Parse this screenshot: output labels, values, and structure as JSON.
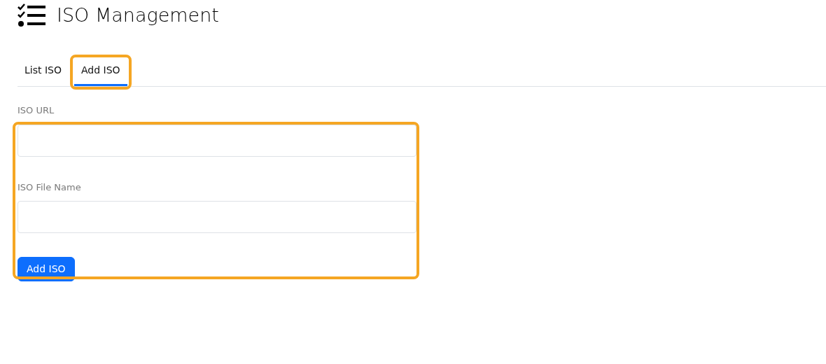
{
  "header": {
    "title": "ISO Management"
  },
  "tabs": [
    {
      "label": "List ISO",
      "selected": false,
      "highlighted": false
    },
    {
      "label": "Add ISO",
      "selected": true,
      "highlighted": true
    }
  ],
  "form": {
    "highlighted": true,
    "fields": [
      {
        "label": "ISO URL"
      },
      {
        "label": "ISO File Name"
      }
    ],
    "submit": "Add ISO"
  }
}
